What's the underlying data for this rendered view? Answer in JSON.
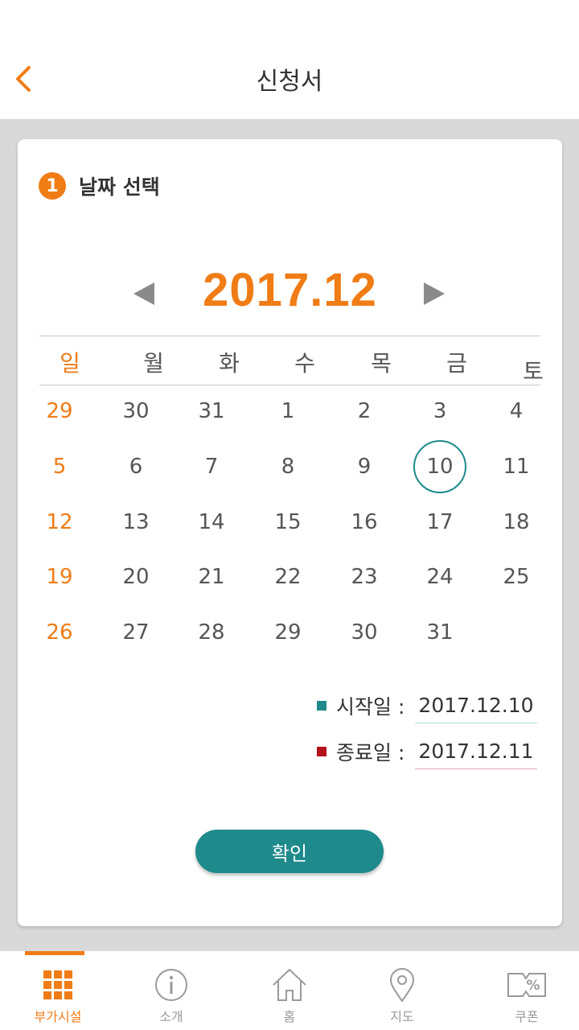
{
  "header": {
    "title": "신청서"
  },
  "step": {
    "number": "1",
    "label": "날짜 선택"
  },
  "calendar": {
    "month_label": "2017.12",
    "weekdays": [
      "일",
      "월",
      "화",
      "수",
      "목",
      "금",
      "토"
    ],
    "weeks": [
      [
        "29",
        "30",
        "31",
        "1",
        "2",
        "3",
        "4"
      ],
      [
        "5",
        "6",
        "7",
        "8",
        "9",
        "10",
        "11"
      ],
      [
        "12",
        "13",
        "14",
        "15",
        "16",
        "17",
        "18"
      ],
      [
        "19",
        "20",
        "21",
        "22",
        "23",
        "24",
        "25"
      ],
      [
        "26",
        "27",
        "28",
        "29",
        "30",
        "31",
        ""
      ]
    ],
    "selected_day": "10"
  },
  "range": {
    "start_label": "시작일 :",
    "start_value": "2017.12.10",
    "end_label": "종료일 :",
    "end_value": "2017.12.11"
  },
  "confirm_label": "확인",
  "tabs": [
    {
      "label": "부가시설",
      "icon": "grid-icon",
      "active": true
    },
    {
      "label": "소개",
      "icon": "info-icon",
      "active": false
    },
    {
      "label": "홈",
      "icon": "home-icon",
      "active": false
    },
    {
      "label": "지도",
      "icon": "map-pin-icon",
      "active": false
    },
    {
      "label": "쿠폰",
      "icon": "coupon-icon",
      "active": false
    }
  ],
  "colors": {
    "accent": "#f07c16",
    "teal": "#1e8a8c",
    "start_marker": "#1e8a8c",
    "end_marker": "#b5121b"
  }
}
